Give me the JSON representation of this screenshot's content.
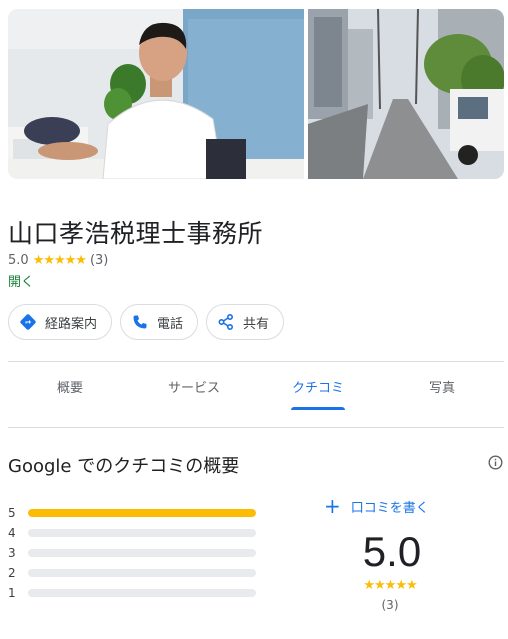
{
  "place": {
    "name": "山口孝浩税理士事務所",
    "rating": "5.0",
    "stars": "★★★★★",
    "review_count": "(3)",
    "status": "開く"
  },
  "actions": [
    {
      "label": "経路案内",
      "icon": "directions-icon"
    },
    {
      "label": "電話",
      "icon": "phone-icon"
    },
    {
      "label": "共有",
      "icon": "share-icon"
    }
  ],
  "tabs": [
    {
      "label": "概要"
    },
    {
      "label": "サービス"
    },
    {
      "label": "クチコミ"
    },
    {
      "label": "写真"
    }
  ],
  "active_tab": "クチコミ",
  "reviews": {
    "title": "Google でのクチコミの概要",
    "write_label": "口コミを書く",
    "score": "5.0",
    "stars": "★★★★★",
    "count": "(3)",
    "distribution": [
      {
        "stars": "5",
        "fraction": 1.0
      },
      {
        "stars": "4",
        "fraction": 0.0
      },
      {
        "stars": "3",
        "fraction": 0.0
      },
      {
        "stars": "2",
        "fraction": 0.0
      },
      {
        "stars": "1",
        "fraction": 0.0
      }
    ]
  },
  "colors": {
    "accent": "#1a73e8",
    "star": "#fbbc04",
    "open": "#188038"
  }
}
